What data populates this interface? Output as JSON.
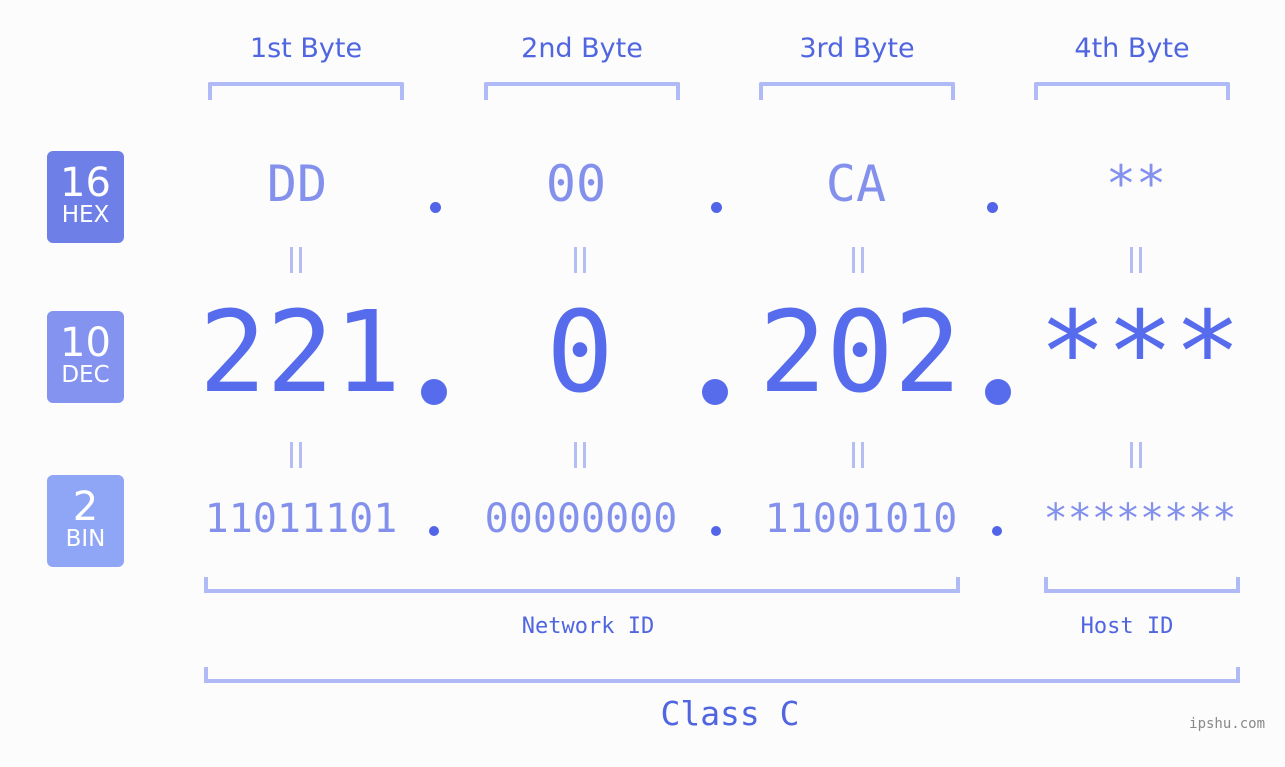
{
  "bytes": [
    {
      "header": "1st Byte",
      "hex": "DD",
      "dec": "221",
      "bin": "11011101"
    },
    {
      "header": "2nd Byte",
      "hex": "00",
      "dec": "0",
      "bin": "00000000"
    },
    {
      "header": "3rd Byte",
      "hex": "CA",
      "dec": "202",
      "bin": "11001010"
    },
    {
      "header": "4th Byte",
      "hex": "**",
      "dec": "***",
      "bin": "********"
    }
  ],
  "bases": {
    "hex": {
      "num": "16",
      "label": "HEX",
      "color": "#6f7fe8"
    },
    "dec": {
      "num": "10",
      "label": "DEC",
      "color": "#8393ef"
    },
    "bin": {
      "num": "2",
      "label": "BIN",
      "color": "#8fa6f7"
    }
  },
  "segments": {
    "network": "Network ID",
    "host": "Host ID",
    "class": "Class C"
  },
  "watermark": "ipshu.com",
  "colors": {
    "accent": "#566cec",
    "light_value": "#8391ec",
    "bracket": "#b0baf6",
    "background": "#fbfcfb"
  }
}
